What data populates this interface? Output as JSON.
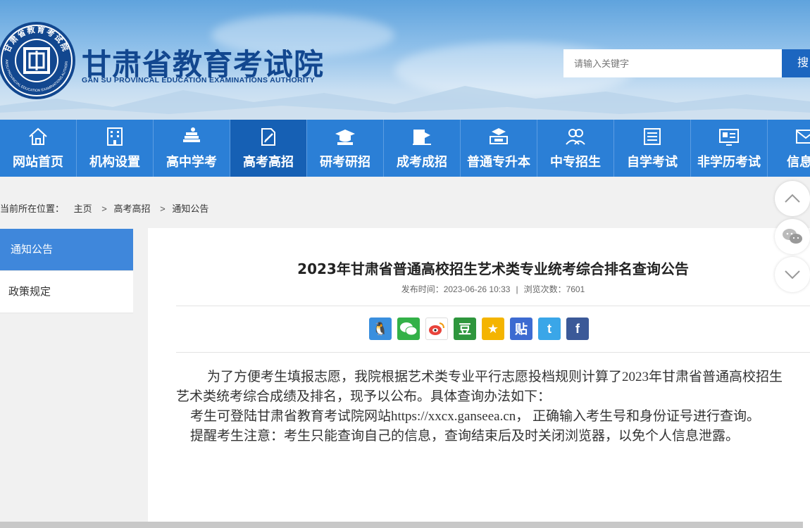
{
  "header": {
    "title": "甘肃省教育考试院",
    "subtitle": "GAN SU PROVINCAL EDUCATION EXAMINATIONS AUTHORITY",
    "seal_text": "甘肃省教育考试院",
    "seal_text_en": "GANSU PROVINCIAL EDUCATION EXAMINATIONS AUTHORITY",
    "search_placeholder": "请输入关键字",
    "search_button": "搜"
  },
  "nav": [
    {
      "label": "网站首页",
      "icon": "home-icon"
    },
    {
      "label": "机构设置",
      "icon": "building-icon"
    },
    {
      "label": "高中学考",
      "icon": "books-icon"
    },
    {
      "label": "高考高招",
      "icon": "pen-paper-icon",
      "active": true
    },
    {
      "label": "研考研招",
      "icon": "graduation-cap-icon"
    },
    {
      "label": "成考成招",
      "icon": "book-flag-icon"
    },
    {
      "label": "普通专升本",
      "icon": "cap-desk-icon"
    },
    {
      "label": "中专招生",
      "icon": "users-icon"
    },
    {
      "label": "自学考试",
      "icon": "list-icon"
    },
    {
      "label": "非学历考试",
      "icon": "id-card-icon"
    },
    {
      "label": "信息公",
      "icon": "mail-icon"
    }
  ],
  "breadcrumb": {
    "prefix": "您当前所在位置：",
    "items": [
      "主页",
      "高考高招",
      "通知公告"
    ],
    "separator": ">"
  },
  "sidebar": {
    "items": [
      {
        "label": "通知公告",
        "active": true
      },
      {
        "label": "政策规定",
        "active": false
      }
    ]
  },
  "article": {
    "title": "2023年甘肃省普通高校招生艺术类专业统考综合排名查询公告",
    "publish_label": "发布时间：2023-06-26 10:33",
    "divider": "|",
    "views_label": "浏览次数：7601",
    "share_icons": [
      "qq-icon",
      "wechat-icon",
      "weibo-icon",
      "douban-icon",
      "qzone-icon",
      "tieba-icon",
      "twitter-icon",
      "facebook-icon"
    ],
    "share_glyphs": [
      "🐧",
      "",
      "",
      "豆",
      "★",
      "贴",
      "t",
      "f"
    ],
    "paragraph1_line1": "为了方便考生填报志愿，我院根据艺术类专业平行志愿投档规则计算了2023年甘肃省普通高校招生",
    "paragraph1_line2": "艺术类统考综合成绩及排名，现予以公布。具体查询办法如下：",
    "paragraph2": "考生可登陆甘肃省教育考试院网站https://xxcx.ganseea.cn，  正确输入考生号和身份证号进行查询。",
    "paragraph3": "提醒考生注意：考生只能查询自己的信息，查询结束后及时关闭浏览器，以免个人信息泄露。"
  },
  "colors": {
    "nav_bg": "#2b7fd6",
    "nav_active": "#1660b4",
    "brand_blue": "#12478f",
    "sidebar_active": "#3f87db"
  }
}
